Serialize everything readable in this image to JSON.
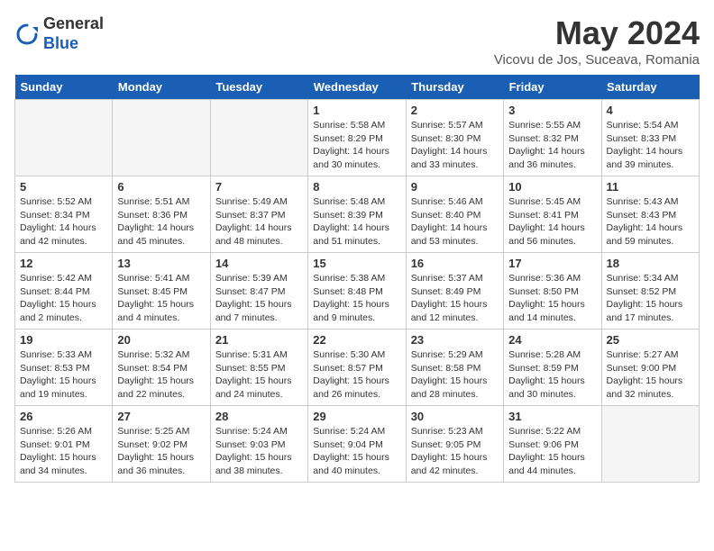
{
  "header": {
    "logo_general": "General",
    "logo_blue": "Blue",
    "month": "May 2024",
    "location": "Vicovu de Jos, Suceava, Romania"
  },
  "weekdays": [
    "Sunday",
    "Monday",
    "Tuesday",
    "Wednesday",
    "Thursday",
    "Friday",
    "Saturday"
  ],
  "weeks": [
    [
      {
        "day": "",
        "info": ""
      },
      {
        "day": "",
        "info": ""
      },
      {
        "day": "",
        "info": ""
      },
      {
        "day": "1",
        "info": "Sunrise: 5:58 AM\nSunset: 8:29 PM\nDaylight: 14 hours\nand 30 minutes."
      },
      {
        "day": "2",
        "info": "Sunrise: 5:57 AM\nSunset: 8:30 PM\nDaylight: 14 hours\nand 33 minutes."
      },
      {
        "day": "3",
        "info": "Sunrise: 5:55 AM\nSunset: 8:32 PM\nDaylight: 14 hours\nand 36 minutes."
      },
      {
        "day": "4",
        "info": "Sunrise: 5:54 AM\nSunset: 8:33 PM\nDaylight: 14 hours\nand 39 minutes."
      }
    ],
    [
      {
        "day": "5",
        "info": "Sunrise: 5:52 AM\nSunset: 8:34 PM\nDaylight: 14 hours\nand 42 minutes."
      },
      {
        "day": "6",
        "info": "Sunrise: 5:51 AM\nSunset: 8:36 PM\nDaylight: 14 hours\nand 45 minutes."
      },
      {
        "day": "7",
        "info": "Sunrise: 5:49 AM\nSunset: 8:37 PM\nDaylight: 14 hours\nand 48 minutes."
      },
      {
        "day": "8",
        "info": "Sunrise: 5:48 AM\nSunset: 8:39 PM\nDaylight: 14 hours\nand 51 minutes."
      },
      {
        "day": "9",
        "info": "Sunrise: 5:46 AM\nSunset: 8:40 PM\nDaylight: 14 hours\nand 53 minutes."
      },
      {
        "day": "10",
        "info": "Sunrise: 5:45 AM\nSunset: 8:41 PM\nDaylight: 14 hours\nand 56 minutes."
      },
      {
        "day": "11",
        "info": "Sunrise: 5:43 AM\nSunset: 8:43 PM\nDaylight: 14 hours\nand 59 minutes."
      }
    ],
    [
      {
        "day": "12",
        "info": "Sunrise: 5:42 AM\nSunset: 8:44 PM\nDaylight: 15 hours\nand 2 minutes."
      },
      {
        "day": "13",
        "info": "Sunrise: 5:41 AM\nSunset: 8:45 PM\nDaylight: 15 hours\nand 4 minutes."
      },
      {
        "day": "14",
        "info": "Sunrise: 5:39 AM\nSunset: 8:47 PM\nDaylight: 15 hours\nand 7 minutes."
      },
      {
        "day": "15",
        "info": "Sunrise: 5:38 AM\nSunset: 8:48 PM\nDaylight: 15 hours\nand 9 minutes."
      },
      {
        "day": "16",
        "info": "Sunrise: 5:37 AM\nSunset: 8:49 PM\nDaylight: 15 hours\nand 12 minutes."
      },
      {
        "day": "17",
        "info": "Sunrise: 5:36 AM\nSunset: 8:50 PM\nDaylight: 15 hours\nand 14 minutes."
      },
      {
        "day": "18",
        "info": "Sunrise: 5:34 AM\nSunset: 8:52 PM\nDaylight: 15 hours\nand 17 minutes."
      }
    ],
    [
      {
        "day": "19",
        "info": "Sunrise: 5:33 AM\nSunset: 8:53 PM\nDaylight: 15 hours\nand 19 minutes."
      },
      {
        "day": "20",
        "info": "Sunrise: 5:32 AM\nSunset: 8:54 PM\nDaylight: 15 hours\nand 22 minutes."
      },
      {
        "day": "21",
        "info": "Sunrise: 5:31 AM\nSunset: 8:55 PM\nDaylight: 15 hours\nand 24 minutes."
      },
      {
        "day": "22",
        "info": "Sunrise: 5:30 AM\nSunset: 8:57 PM\nDaylight: 15 hours\nand 26 minutes."
      },
      {
        "day": "23",
        "info": "Sunrise: 5:29 AM\nSunset: 8:58 PM\nDaylight: 15 hours\nand 28 minutes."
      },
      {
        "day": "24",
        "info": "Sunrise: 5:28 AM\nSunset: 8:59 PM\nDaylight: 15 hours\nand 30 minutes."
      },
      {
        "day": "25",
        "info": "Sunrise: 5:27 AM\nSunset: 9:00 PM\nDaylight: 15 hours\nand 32 minutes."
      }
    ],
    [
      {
        "day": "26",
        "info": "Sunrise: 5:26 AM\nSunset: 9:01 PM\nDaylight: 15 hours\nand 34 minutes."
      },
      {
        "day": "27",
        "info": "Sunrise: 5:25 AM\nSunset: 9:02 PM\nDaylight: 15 hours\nand 36 minutes."
      },
      {
        "day": "28",
        "info": "Sunrise: 5:24 AM\nSunset: 9:03 PM\nDaylight: 15 hours\nand 38 minutes."
      },
      {
        "day": "29",
        "info": "Sunrise: 5:24 AM\nSunset: 9:04 PM\nDaylight: 15 hours\nand 40 minutes."
      },
      {
        "day": "30",
        "info": "Sunrise: 5:23 AM\nSunset: 9:05 PM\nDaylight: 15 hours\nand 42 minutes."
      },
      {
        "day": "31",
        "info": "Sunrise: 5:22 AM\nSunset: 9:06 PM\nDaylight: 15 hours\nand 44 minutes."
      },
      {
        "day": "",
        "info": ""
      }
    ]
  ]
}
